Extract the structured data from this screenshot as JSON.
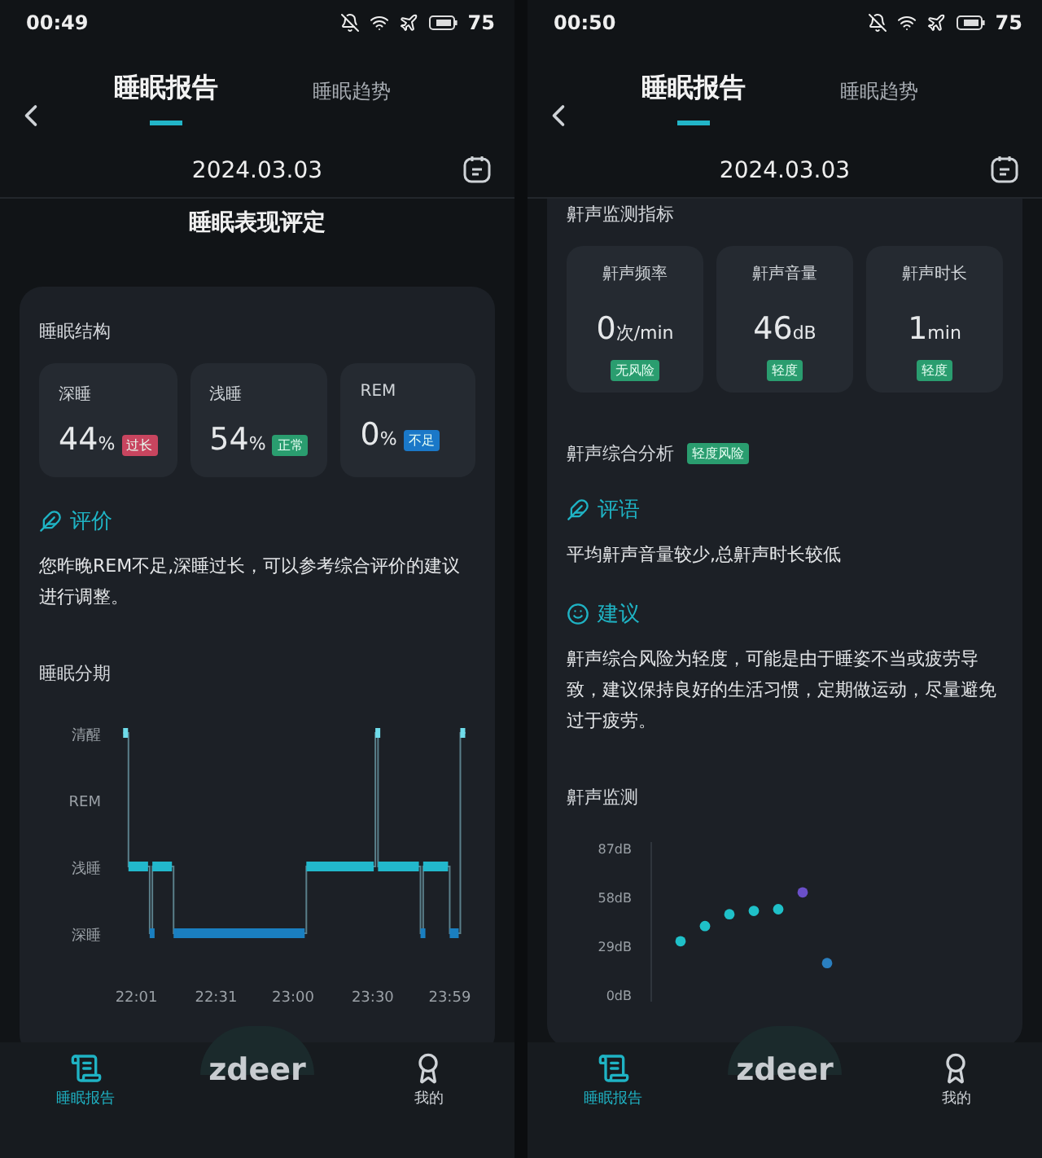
{
  "phones": [
    {
      "status_bar": {
        "time": "00:49",
        "battery": "75"
      },
      "tabs": [
        {
          "label": "睡眠报告",
          "selected": true
        },
        {
          "label": "睡眠趋势",
          "selected": false
        }
      ],
      "date": "2024.03.03",
      "title": "睡眠表现评定",
      "sections": [
        {
          "kind": "label",
          "text": "睡眠结构"
        },
        {
          "kind": "tiles_inline",
          "items": [
            {
              "label": "深睡",
              "value": "44",
              "unit": "%",
              "badge": "过长",
              "color": "#c8455f"
            },
            {
              "label": "浅睡",
              "value": "54",
              "unit": "%",
              "badge": "正常",
              "color": "#2a9d6f"
            },
            {
              "label": "REM",
              "value": "0",
              "unit": "%",
              "badge": "不足",
              "color": "#1a78c8"
            }
          ]
        },
        {
          "kind": "comment",
          "heading": "评价",
          "text": "您昨晚REM不足,深睡过长，可以参考综合评价的建议进行调整。"
        },
        {
          "kind": "label",
          "text": "睡眠分期"
        },
        {
          "kind": "hypnogram",
          "stage_labels": [
            "清醒",
            "REM",
            "浅睡",
            "深睡"
          ],
          "time_labels": [
            "22:01",
            "22:31",
            "23:00",
            "23:30",
            "23:59"
          ]
        }
      ],
      "nav": [
        {
          "label": "睡眠报告",
          "selected": true
        },
        {
          "label": "我的",
          "selected": false
        }
      ],
      "logo": "zdeer"
    },
    {
      "status_bar": {
        "time": "00:50",
        "battery": "75"
      },
      "tabs": [
        {
          "label": "睡眠报告",
          "selected": true
        },
        {
          "label": "睡眠趋势",
          "selected": false
        }
      ],
      "date": "2024.03.03",
      "sections": [
        {
          "kind": "label",
          "text": "鼾声监测指标"
        },
        {
          "kind": "tiles_stacked",
          "items": [
            {
              "label": "鼾声频率",
              "value": "0",
              "unit": "次/min",
              "badge": "无风险",
              "color": "#2a9d6f"
            },
            {
              "label": "鼾声音量",
              "value": "46",
              "unit": "dB",
              "badge": "轻度",
              "color": "#2a9d6f"
            },
            {
              "label": "鼾声时长",
              "value": "1",
              "unit": "min",
              "badge": "轻度",
              "color": "#2a9d6f"
            }
          ]
        },
        {
          "kind": "label",
          "text": "鼾声综合分析",
          "badge": "轻度风险",
          "color": "#2a9d6f"
        },
        {
          "kind": "comment",
          "heading": "评语",
          "text": "平均鼾声音量较少,总鼾声时长较低"
        },
        {
          "kind": "comment",
          "heading": "建议",
          "text": "鼾声综合风险为轻度，可能是由于睡姿不当或疲劳导致，建议保持良好的生活习惯，定期做运动，尽量避免过于疲劳。"
        },
        {
          "kind": "label",
          "text": "鼾声监测"
        },
        {
          "kind": "dot_plot",
          "level_labels": [
            "87dB",
            "58dB",
            "29dB",
            "0dB"
          ]
        }
      ],
      "nav": [
        {
          "label": "睡眠报告",
          "selected": true
        },
        {
          "label": "我的",
          "selected": false
        }
      ],
      "logo": "zdeer"
    }
  ]
}
